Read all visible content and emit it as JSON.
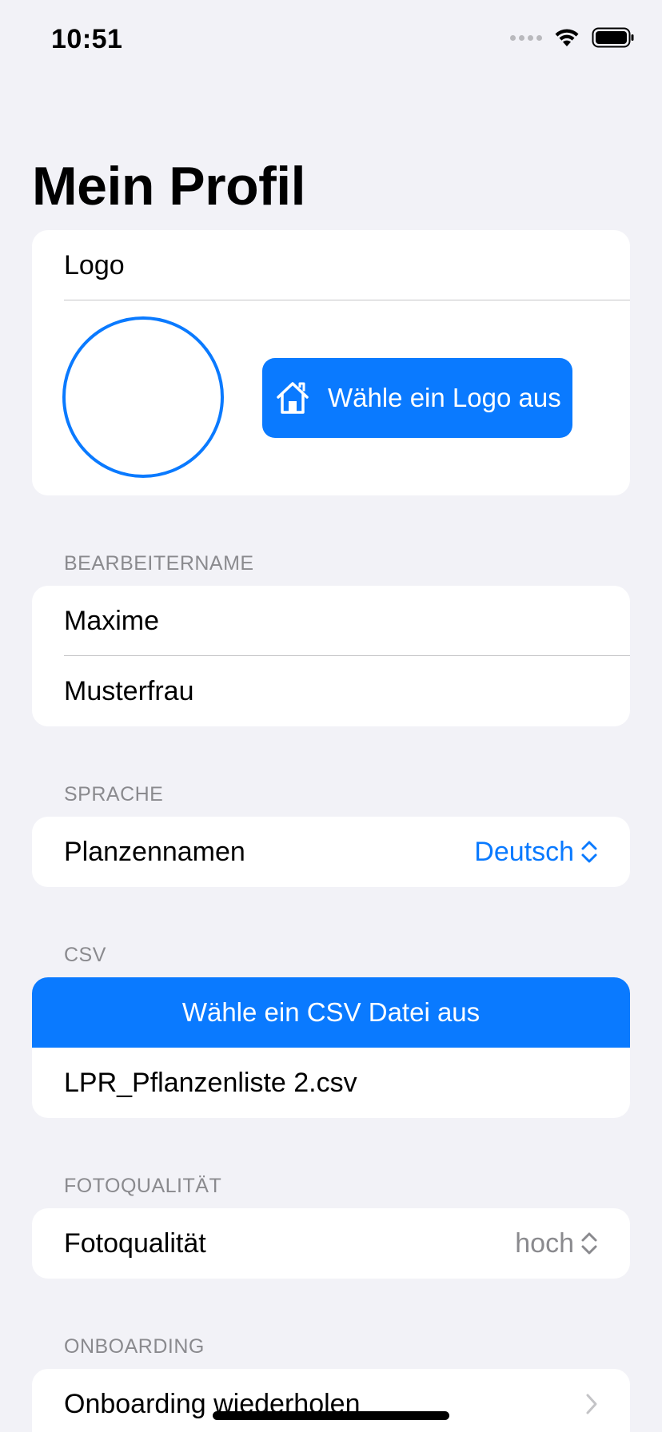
{
  "status_bar": {
    "time": "10:51"
  },
  "page_title": "Mein Profil",
  "logo_section": {
    "title": "Logo",
    "choose_button_label": "Wähle ein Logo aus"
  },
  "editor_name_section": {
    "header": "BEARBEITERNAME",
    "first_name": "Maxime",
    "last_name": "Musterfrau"
  },
  "language_section": {
    "header": "SPRACHE",
    "label": "Planzennamen",
    "value": "Deutsch"
  },
  "csv_section": {
    "header": "CSV",
    "choose_button_label": "Wähle ein CSV Datei aus",
    "file_name": "LPR_Pflanzenliste 2.csv"
  },
  "photo_section": {
    "header": "FOTOQUALITÄT",
    "label": "Fotoqualität",
    "value": "hoch"
  },
  "onboarding_section": {
    "header": "ONBOARDING",
    "label": "Onboarding wiederholen"
  },
  "colors": {
    "accent": "#0a7aff",
    "background": "#f2f2f7",
    "secondary_text": "#8a8a8e"
  }
}
